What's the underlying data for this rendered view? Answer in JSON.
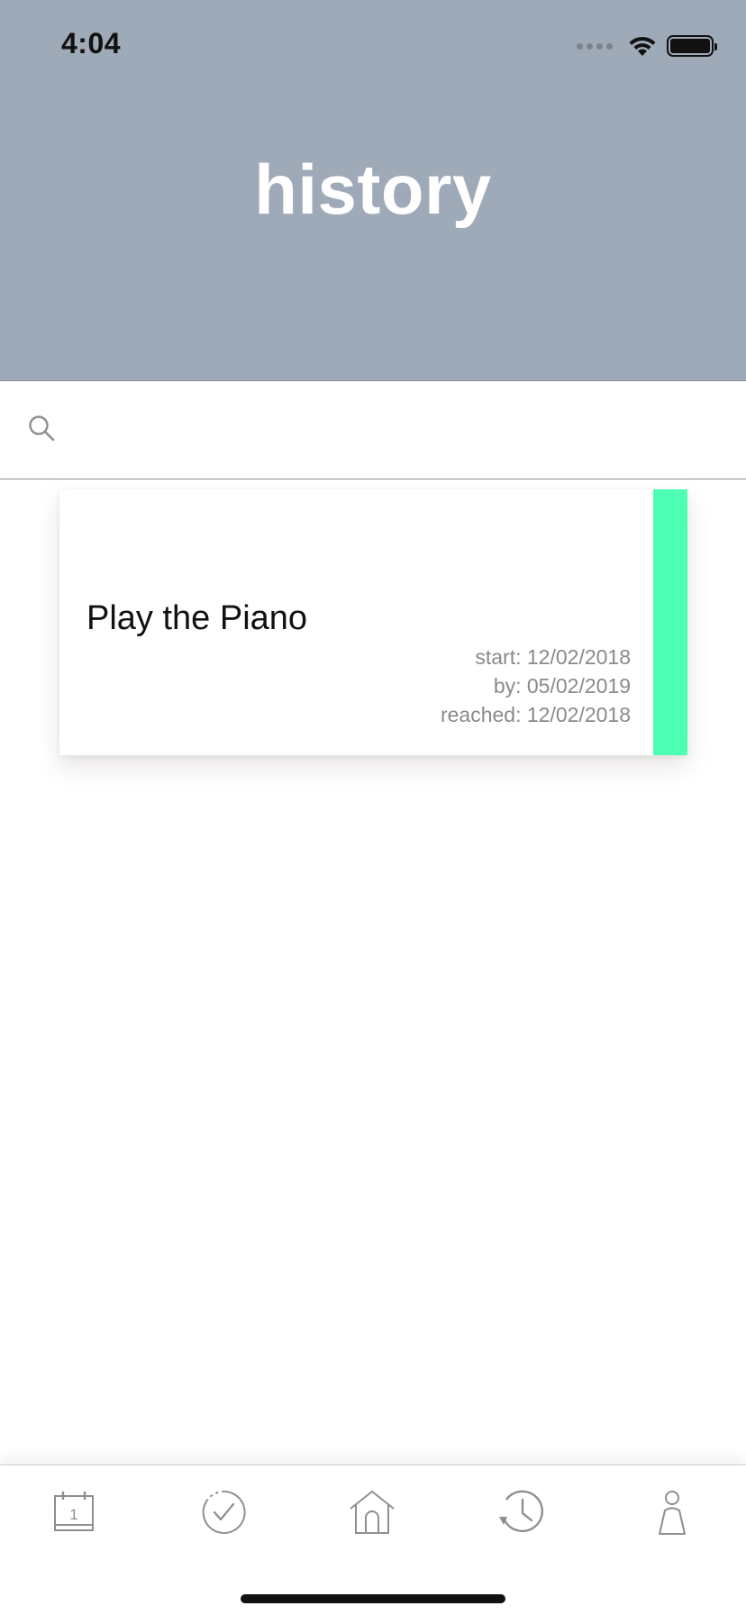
{
  "status_bar": {
    "time": "4:04"
  },
  "header": {
    "title": "history",
    "background_color": "#9eaab8"
  },
  "search": {
    "placeholder": "",
    "value": ""
  },
  "goals": [
    {
      "title": "Play the Piano",
      "start": "start: 12/02/2018",
      "by": "by: 05/02/2019",
      "reached": "reached: 12/02/2018",
      "accent_color": "#4cffb3"
    }
  ],
  "tab_bar": {
    "tabs": [
      {
        "icon": "calendar-icon",
        "calendar_day": "1"
      },
      {
        "icon": "check-circle-icon"
      },
      {
        "icon": "home-icon"
      },
      {
        "icon": "history-clock-icon"
      },
      {
        "icon": "person-icon"
      }
    ]
  }
}
